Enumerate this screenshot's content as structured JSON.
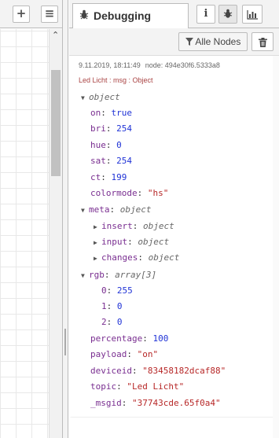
{
  "left_toolbar": {
    "add_icon": "+",
    "list_icon": "≡"
  },
  "sidebar": {
    "tab_label": "Debugging",
    "tab_icon": "bug-icon",
    "info_icon": "i",
    "debug_icon": "bug-icon",
    "chart_icon": "bar-chart-icon"
  },
  "debug_toolbar": {
    "filter_label": "Alle Nodes",
    "filter_icon": "funnel-icon",
    "clear_icon": "trash-icon"
  },
  "message": {
    "timestamp": "9.11.2019, 18:11:49",
    "node": "node: 494e30f6.5333a8",
    "name": "Led Licht : msg : Object",
    "root_type": "object",
    "fields": [
      {
        "key": "on",
        "value": "true",
        "kind": "bool"
      },
      {
        "key": "bri",
        "value": "254",
        "kind": "num"
      },
      {
        "key": "hue",
        "value": "0",
        "kind": "num"
      },
      {
        "key": "sat",
        "value": "254",
        "kind": "num"
      },
      {
        "key": "ct",
        "value": "199",
        "kind": "num"
      },
      {
        "key": "colormode",
        "value": "\"hs\"",
        "kind": "str"
      }
    ],
    "meta": {
      "key": "meta",
      "type": "object",
      "children": [
        {
          "key": "insert",
          "type": "object"
        },
        {
          "key": "input",
          "type": "object"
        },
        {
          "key": "changes",
          "type": "object"
        }
      ]
    },
    "rgb": {
      "key": "rgb",
      "type": "array[3]",
      "items": [
        {
          "key": "0",
          "value": "255"
        },
        {
          "key": "1",
          "value": "0"
        },
        {
          "key": "2",
          "value": "0"
        }
      ]
    },
    "tail": [
      {
        "key": "percentage",
        "value": "100",
        "kind": "num"
      },
      {
        "key": "payload",
        "value": "\"on\"",
        "kind": "str"
      },
      {
        "key": "deviceid",
        "value": "\"83458182dcaf88\"",
        "kind": "str"
      },
      {
        "key": "topic",
        "value": "\"Led Licht\"",
        "kind": "str"
      },
      {
        "key": "_msgid",
        "value": "\"37743cde.65f0a4\"",
        "kind": "str"
      }
    ]
  }
}
